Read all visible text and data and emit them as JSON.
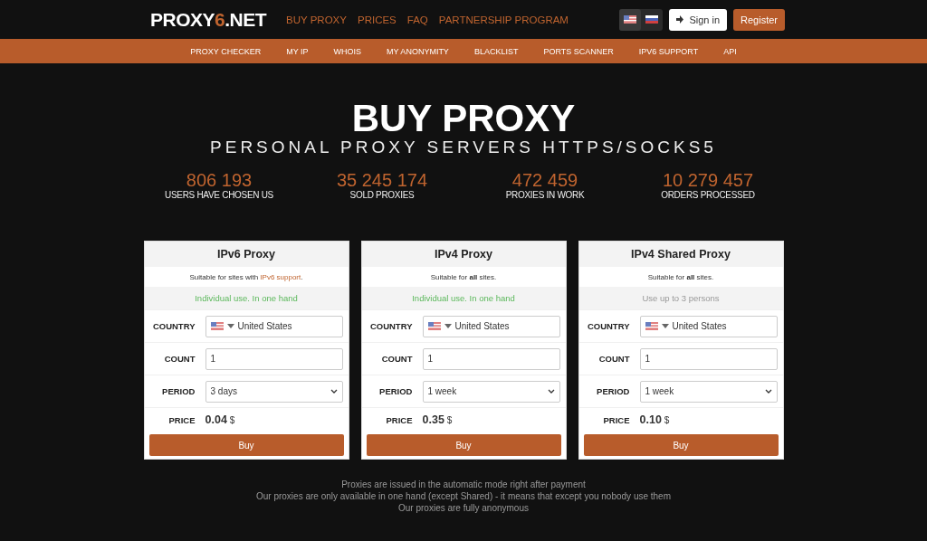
{
  "logo": {
    "prefix": "PROXY",
    "accent": "6",
    "suffix": ".NET"
  },
  "top_nav": [
    "BUY PROXY",
    "PRICES",
    "FAQ",
    "PARTNERSHIP PROGRAM"
  ],
  "languages": [
    {
      "kind": "us",
      "selected": true
    },
    {
      "kind": "ru",
      "selected": false
    }
  ],
  "sign_in": "Sign in",
  "register": "Register",
  "sub_nav": [
    "PROXY CHECKER",
    "MY IP",
    "WHOIS",
    "MY ANONYMITY",
    "BLACKLIST",
    "PORTS SCANNER",
    "IPV6 SUPPORT",
    "API"
  ],
  "title": "BUY PROXY",
  "subtitle": "PERSONAL PROXY SERVERS HTTPS/SOCKS5",
  "stats": [
    {
      "value": "806 193",
      "label": "USERS HAVE CHOSEN US"
    },
    {
      "value": "35 245 174",
      "label": "SOLD PROXIES"
    },
    {
      "value": "472 459",
      "label": "PROXIES IN WORK"
    },
    {
      "value": "10 279 457",
      "label": "ORDERS PROCESSED"
    }
  ],
  "cards": [
    {
      "title": "IPv6 Proxy",
      "description": [
        {
          "kind": "text",
          "text": "Suitable for sites with "
        },
        {
          "kind": "link",
          "text": "IPv6 support"
        },
        {
          "kind": "text",
          "text": "."
        }
      ],
      "note": "Individual use. In one hand",
      "individual": true,
      "country_label": "COUNTRY",
      "country": "United States",
      "count_label": "COUNT",
      "count": "1",
      "period_label": "PERIOD",
      "period": "3 days",
      "price_label": "PRICE",
      "price": "0.04",
      "currency": "$",
      "buy": "Buy"
    },
    {
      "title": "IPv4 Proxy",
      "description": [
        {
          "kind": "text",
          "text": "Suitable for "
        },
        {
          "kind": "bold",
          "text": "all"
        },
        {
          "kind": "text",
          "text": " sites."
        }
      ],
      "note": "Individual use. In one hand",
      "individual": true,
      "country_label": "COUNTRY",
      "country": "United States",
      "count_label": "COUNT",
      "count": "1",
      "period_label": "PERIOD",
      "period": "1 week",
      "price_label": "PRICE",
      "price": "0.35",
      "currency": "$",
      "buy": "Buy"
    },
    {
      "title": "IPv4 Shared Proxy",
      "description": [
        {
          "kind": "text",
          "text": "Suitable for "
        },
        {
          "kind": "bold",
          "text": "all"
        },
        {
          "kind": "text",
          "text": " sites."
        }
      ],
      "note": "Use up to 3 persons",
      "individual": false,
      "country_label": "COUNTRY",
      "country": "United States",
      "count_label": "COUNT",
      "count": "1",
      "period_label": "PERIOD",
      "period": "1 week",
      "price_label": "PRICE",
      "price": "0.10",
      "currency": "$",
      "buy": "Buy"
    }
  ],
  "footer_notes": [
    "Proxies are issued in the automatic mode right after payment",
    "Our proxies are only available in one hand (except Shared) - it means that except you nobody use them",
    "Our proxies are fully anonymous"
  ]
}
